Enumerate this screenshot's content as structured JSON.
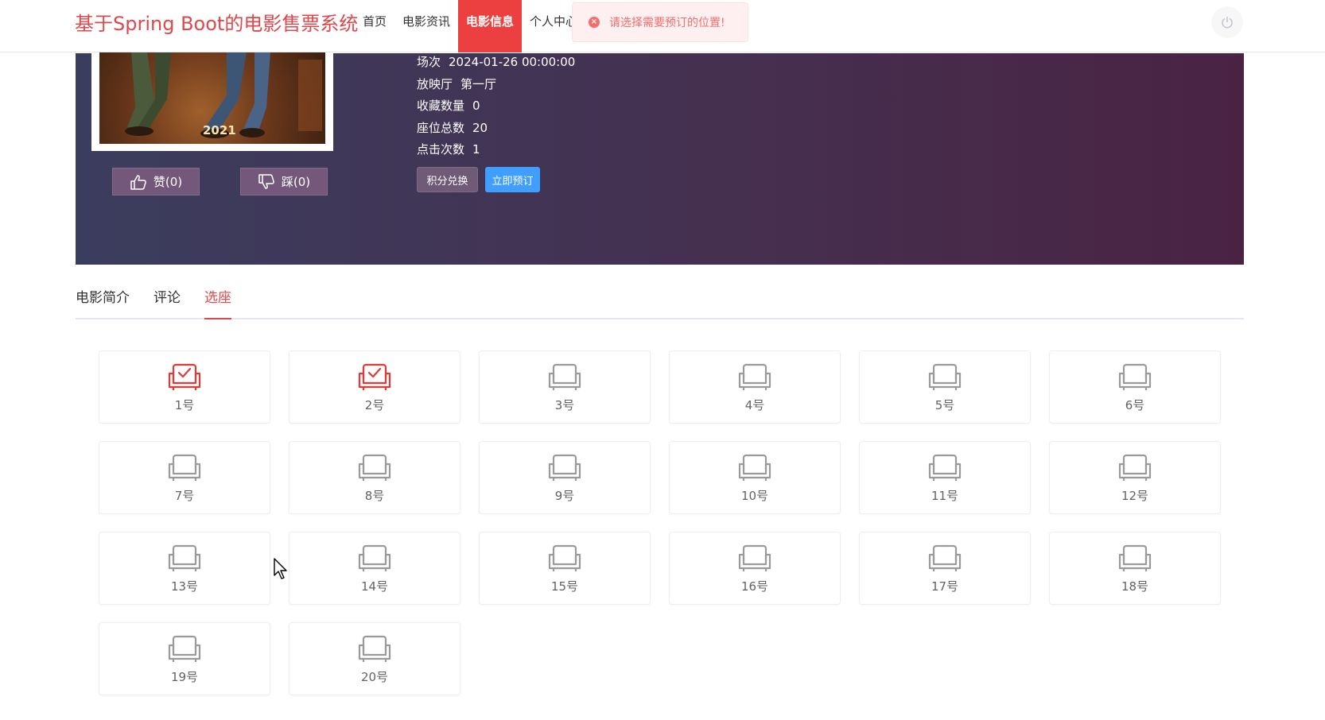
{
  "header": {
    "logo": "基于Spring Boot的电影售票系统",
    "nav": [
      {
        "label": "首页",
        "active": false
      },
      {
        "label": "电影资讯",
        "active": false
      },
      {
        "label": "电影信息",
        "active": true
      },
      {
        "label": "个人中心",
        "active": false
      }
    ],
    "power_icon": "power-icon"
  },
  "toast": {
    "type": "error",
    "message": "请选择需要预订的位置!",
    "icon": "close-circle-icon"
  },
  "movie": {
    "poster_year": "2021",
    "like_label": "赞(0)",
    "dislike_label": "踩(0)",
    "info": [
      {
        "key": "场次",
        "value": "2024-01-26 00:00:00"
      },
      {
        "key": "放映厅",
        "value": "第一厅"
      },
      {
        "key": "收藏数量",
        "value": "0"
      },
      {
        "key": "座位总数",
        "value": "20"
      },
      {
        "key": "点击次数",
        "value": "1"
      }
    ],
    "exchange_label": "积分兑换",
    "book_label": "立即预订"
  },
  "tabs": [
    {
      "label": "电影简介",
      "active": false
    },
    {
      "label": "评论",
      "active": false
    },
    {
      "label": "选座",
      "active": true
    }
  ],
  "seats": [
    {
      "label": "1号",
      "selected": true
    },
    {
      "label": "2号",
      "selected": true
    },
    {
      "label": "3号",
      "selected": false
    },
    {
      "label": "4号",
      "selected": false
    },
    {
      "label": "5号",
      "selected": false
    },
    {
      "label": "6号",
      "selected": false
    },
    {
      "label": "7号",
      "selected": false
    },
    {
      "label": "8号",
      "selected": false
    },
    {
      "label": "9号",
      "selected": false
    },
    {
      "label": "10号",
      "selected": false
    },
    {
      "label": "11号",
      "selected": false
    },
    {
      "label": "12号",
      "selected": false
    },
    {
      "label": "13号",
      "selected": false
    },
    {
      "label": "14号",
      "selected": false
    },
    {
      "label": "15号",
      "selected": false
    },
    {
      "label": "16号",
      "selected": false
    },
    {
      "label": "17号",
      "selected": false
    },
    {
      "label": "18号",
      "selected": false
    },
    {
      "label": "19号",
      "selected": false
    },
    {
      "label": "20号",
      "selected": false
    }
  ],
  "colors": {
    "brand": "#e0474b",
    "nav_active": "#ec3f3f",
    "seat_selected": "#e53935",
    "seat_free": "#9a9a9a",
    "primary_button": "#409eff"
  }
}
